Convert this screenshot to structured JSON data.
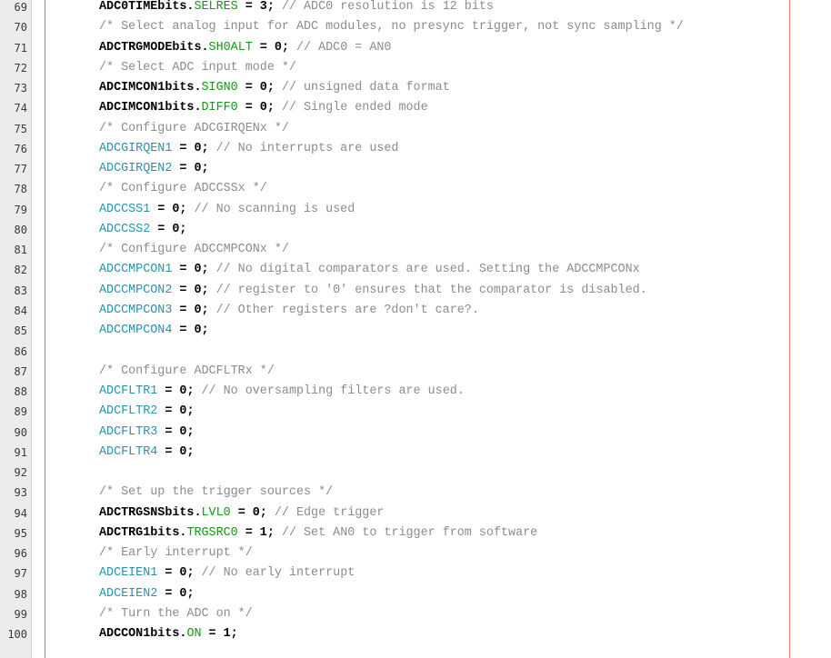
{
  "editor": {
    "colors": {
      "plain": "#000000",
      "register": "#2b91af",
      "field": "#119911",
      "comment": "#8c8c8c",
      "gutter_bg": "#ececec",
      "edge_line": "#ff8080"
    },
    "lines": [
      {
        "num": "69",
        "tokens": [
          {
            "t": "ADC0TIMEbits.",
            "k": "plain"
          },
          {
            "t": "SELRES",
            "k": "field"
          },
          {
            "t": " = 3; ",
            "k": "op"
          },
          {
            "t": "// ADC0 resolution is 12 bits",
            "k": "comment"
          }
        ]
      },
      {
        "num": "70",
        "tokens": [
          {
            "t": "/* Select analog input for ADC modules, no presync trigger, not sync sampling */",
            "k": "comment"
          }
        ]
      },
      {
        "num": "71",
        "tokens": [
          {
            "t": "ADCTRGMODEbits.",
            "k": "plain"
          },
          {
            "t": "SH0ALT",
            "k": "field"
          },
          {
            "t": " = 0; ",
            "k": "op"
          },
          {
            "t": "// ADC0 = AN0",
            "k": "comment"
          }
        ]
      },
      {
        "num": "72",
        "tokens": [
          {
            "t": "/* Select ADC input mode */",
            "k": "comment"
          }
        ]
      },
      {
        "num": "73",
        "tokens": [
          {
            "t": "ADCIMCON1bits.",
            "k": "plain"
          },
          {
            "t": "SIGN0",
            "k": "field"
          },
          {
            "t": " = 0; ",
            "k": "op"
          },
          {
            "t": "// unsigned data format",
            "k": "comment"
          }
        ]
      },
      {
        "num": "74",
        "tokens": [
          {
            "t": "ADCIMCON1bits.",
            "k": "plain"
          },
          {
            "t": "DIFF0",
            "k": "field"
          },
          {
            "t": " = 0; ",
            "k": "op"
          },
          {
            "t": "// Single ended mode",
            "k": "comment"
          }
        ]
      },
      {
        "num": "75",
        "tokens": [
          {
            "t": "/* Configure ADCGIRQENx */",
            "k": "comment"
          }
        ]
      },
      {
        "num": "76",
        "tokens": [
          {
            "t": "ADCGIRQEN1",
            "k": "reg"
          },
          {
            "t": " = 0; ",
            "k": "op"
          },
          {
            "t": "// No interrupts are used",
            "k": "comment"
          }
        ]
      },
      {
        "num": "77",
        "tokens": [
          {
            "t": "ADCGIRQEN2",
            "k": "reg"
          },
          {
            "t": " = 0;",
            "k": "op"
          }
        ]
      },
      {
        "num": "78",
        "tokens": [
          {
            "t": "/* Configure ADCCSSx */",
            "k": "comment"
          }
        ]
      },
      {
        "num": "79",
        "tokens": [
          {
            "t": "ADCCSS1",
            "k": "reg"
          },
          {
            "t": " = 0; ",
            "k": "op"
          },
          {
            "t": "// No scanning is used",
            "k": "comment"
          }
        ]
      },
      {
        "num": "80",
        "tokens": [
          {
            "t": "ADCCSS2",
            "k": "reg"
          },
          {
            "t": " = 0;",
            "k": "op"
          }
        ]
      },
      {
        "num": "81",
        "tokens": [
          {
            "t": "/* Configure ADCCMPCONx */",
            "k": "comment"
          }
        ]
      },
      {
        "num": "82",
        "tokens": [
          {
            "t": "ADCCMPCON1",
            "k": "reg"
          },
          {
            "t": " = 0; ",
            "k": "op"
          },
          {
            "t": "// No digital comparators are used. Setting the ADCCMPCONx",
            "k": "comment"
          }
        ]
      },
      {
        "num": "83",
        "tokens": [
          {
            "t": "ADCCMPCON2",
            "k": "reg"
          },
          {
            "t": " = 0; ",
            "k": "op"
          },
          {
            "t": "// register to '0' ensures that the comparator is disabled.",
            "k": "comment"
          }
        ]
      },
      {
        "num": "84",
        "tokens": [
          {
            "t": "ADCCMPCON3",
            "k": "reg"
          },
          {
            "t": " = 0; ",
            "k": "op"
          },
          {
            "t": "// Other registers are ?don't care?.",
            "k": "comment"
          }
        ]
      },
      {
        "num": "85",
        "tokens": [
          {
            "t": "ADCCMPCON4",
            "k": "reg"
          },
          {
            "t": " = 0;",
            "k": "op"
          }
        ]
      },
      {
        "num": "86",
        "tokens": []
      },
      {
        "num": "87",
        "tokens": [
          {
            "t": "/* Configure ADCFLTRx */",
            "k": "comment"
          }
        ]
      },
      {
        "num": "88",
        "tokens": [
          {
            "t": "ADCFLTR1",
            "k": "reg"
          },
          {
            "t": " = 0; ",
            "k": "op"
          },
          {
            "t": "// No oversampling filters are used.",
            "k": "comment"
          }
        ]
      },
      {
        "num": "89",
        "tokens": [
          {
            "t": "ADCFLTR2",
            "k": "reg"
          },
          {
            "t": " = 0;",
            "k": "op"
          }
        ]
      },
      {
        "num": "90",
        "tokens": [
          {
            "t": "ADCFLTR3",
            "k": "reg"
          },
          {
            "t": " = 0;",
            "k": "op"
          }
        ]
      },
      {
        "num": "91",
        "tokens": [
          {
            "t": "ADCFLTR4",
            "k": "reg"
          },
          {
            "t": " = 0;",
            "k": "op"
          }
        ]
      },
      {
        "num": "92",
        "tokens": []
      },
      {
        "num": "93",
        "tokens": [
          {
            "t": "/* Set up the trigger sources */",
            "k": "comment"
          }
        ]
      },
      {
        "num": "94",
        "tokens": [
          {
            "t": "ADCTRGSNSbits.",
            "k": "plain"
          },
          {
            "t": "LVL0",
            "k": "field"
          },
          {
            "t": " = 0; ",
            "k": "op"
          },
          {
            "t": "// Edge trigger",
            "k": "comment"
          }
        ]
      },
      {
        "num": "95",
        "tokens": [
          {
            "t": "ADCTRG1bits.",
            "k": "plain"
          },
          {
            "t": "TRGSRC0",
            "k": "field"
          },
          {
            "t": " = 1; ",
            "k": "op"
          },
          {
            "t": "// Set AN0 to trigger from software",
            "k": "comment"
          }
        ]
      },
      {
        "num": "96",
        "tokens": [
          {
            "t": "/* Early interrupt */",
            "k": "comment"
          }
        ]
      },
      {
        "num": "97",
        "tokens": [
          {
            "t": "ADCEIEN1",
            "k": "reg"
          },
          {
            "t": " = 0; ",
            "k": "op"
          },
          {
            "t": "// No early interrupt",
            "k": "comment"
          }
        ]
      },
      {
        "num": "98",
        "tokens": [
          {
            "t": "ADCEIEN2",
            "k": "reg"
          },
          {
            "t": " = 0;",
            "k": "op"
          }
        ]
      },
      {
        "num": "99",
        "tokens": [
          {
            "t": "/* Turn the ADC on */",
            "k": "comment"
          }
        ]
      },
      {
        "num": "100",
        "tokens": [
          {
            "t": "ADCCON1bits.",
            "k": "plain"
          },
          {
            "t": "ON",
            "k": "field"
          },
          {
            "t": " = 1;",
            "k": "op"
          }
        ]
      }
    ]
  }
}
